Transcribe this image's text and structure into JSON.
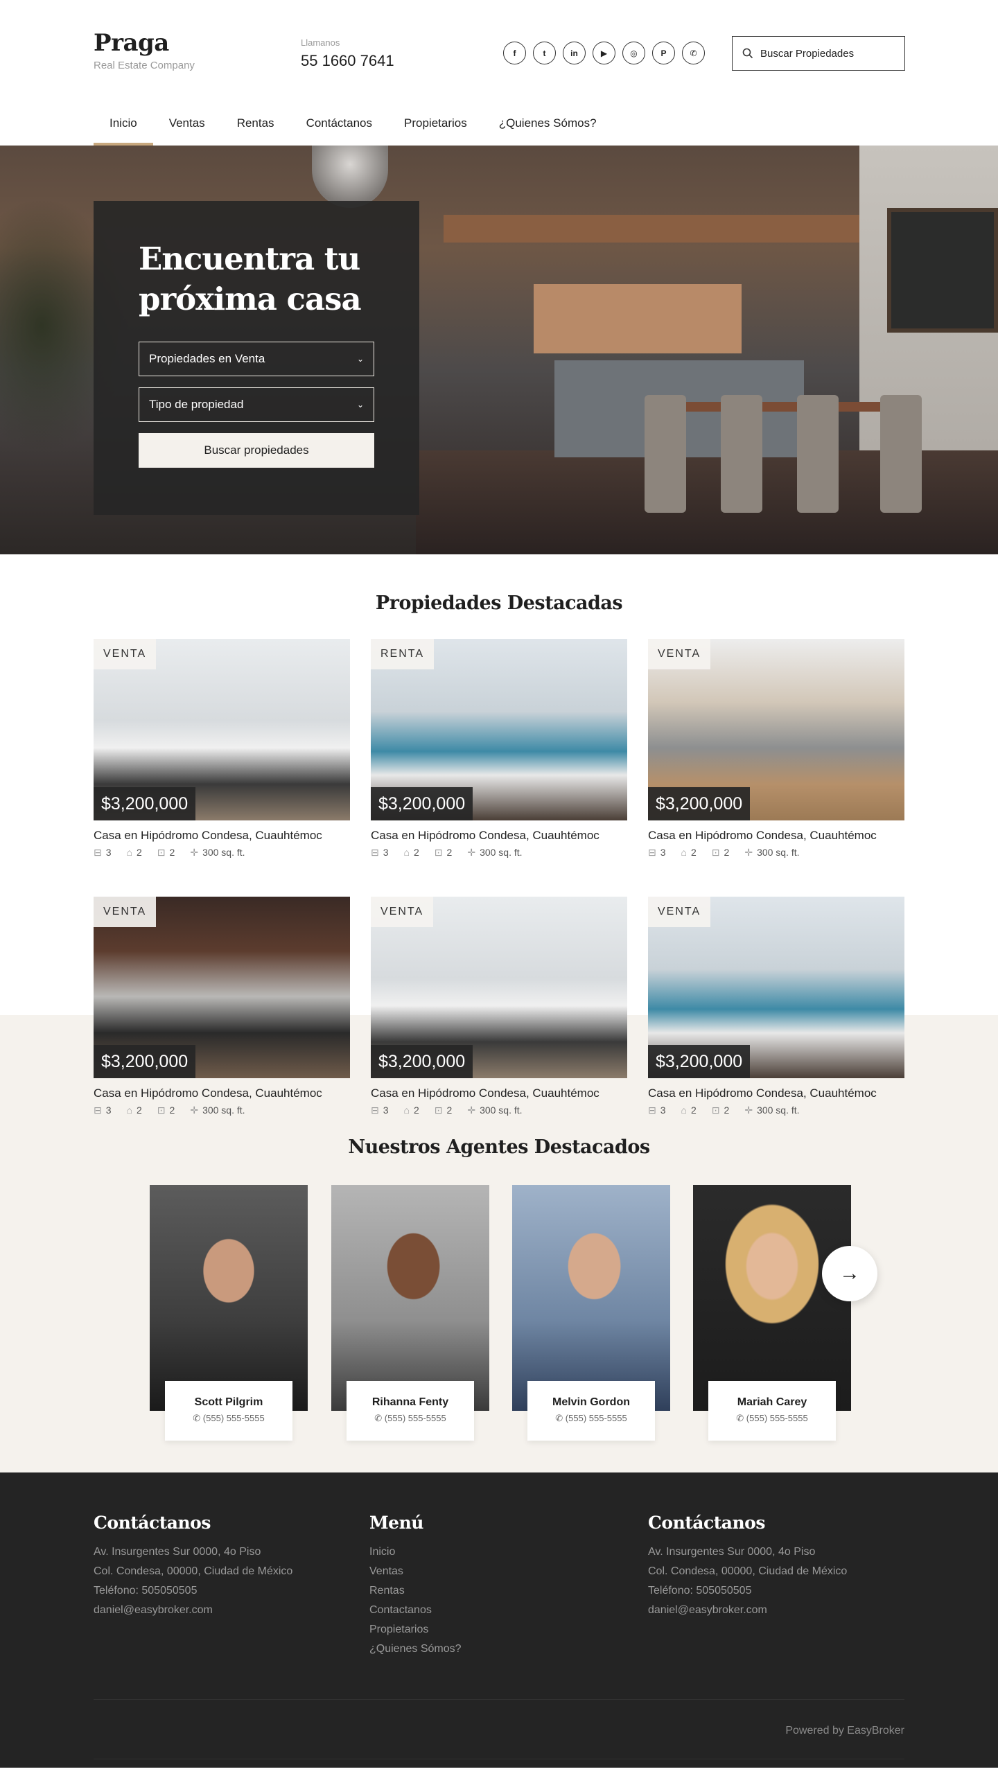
{
  "header": {
    "brand_name": "Praga",
    "brand_sub": "Real Estate Company",
    "call_label": "Llamanos",
    "call_number": "55 1660 7641",
    "socials": [
      "f",
      "t",
      "in",
      "▶",
      "◎",
      "P",
      "✆"
    ],
    "search_placeholder": "Buscar Propiedades"
  },
  "nav": [
    "Inicio",
    "Ventas",
    "Rentas",
    "Contáctanos",
    "Propietarios",
    "¿Quienes Sómos?"
  ],
  "hero": {
    "title_line1": "Encuentra tu",
    "title_line2": "próxima casa",
    "select1": "Propiedades en Venta",
    "select2": "Tipo de propiedad",
    "button": "Buscar propiedades"
  },
  "featured": {
    "title": "Propiedades Destacadas",
    "cards": [
      {
        "tag": "VENTA",
        "price": "$3,200,000",
        "name": "Casa en Hipódromo Condesa, Cuauhtémoc",
        "beds": "3",
        "baths": "2",
        "parking": "2",
        "area": "300 sq. ft."
      },
      {
        "tag": "RENTA",
        "price": "$3,200,000",
        "name": "Casa en Hipódromo Condesa, Cuauhtémoc",
        "beds": "3",
        "baths": "2",
        "parking": "2",
        "area": "300 sq. ft."
      },
      {
        "tag": "VENTA",
        "price": "$3,200,000",
        "name": "Casa en Hipódromo Condesa, Cuauhtémoc",
        "beds": "3",
        "baths": "2",
        "parking": "2",
        "area": "300 sq. ft."
      },
      {
        "tag": "VENTA",
        "price": "$3,200,000",
        "name": "Casa en Hipódromo Condesa, Cuauhtémoc",
        "beds": "3",
        "baths": "2",
        "parking": "2",
        "area": "300 sq. ft."
      },
      {
        "tag": "VENTA",
        "price": "$3,200,000",
        "name": "Casa en Hipódromo Condesa, Cuauhtémoc",
        "beds": "3",
        "baths": "2",
        "parking": "2",
        "area": "300 sq. ft."
      },
      {
        "tag": "VENTA",
        "price": "$3,200,000",
        "name": "Casa en Hipódromo Condesa, Cuauhtémoc",
        "beds": "3",
        "baths": "2",
        "parking": "2",
        "area": "300 sq. ft."
      }
    ]
  },
  "agents": {
    "title": "Nuestros Agentes Destacados",
    "list": [
      {
        "name": "Scott Pilgrim",
        "phone": "(555) 555-5555"
      },
      {
        "name": "Rihanna Fenty",
        "phone": "(555) 555-5555"
      },
      {
        "name": "Melvin Gordon",
        "phone": "(555) 555-5555"
      },
      {
        "name": "Mariah Carey",
        "phone": "(555) 555-5555"
      }
    ]
  },
  "footer": {
    "contact1": {
      "title": "Contáctanos",
      "lines": [
        "Av. Insurgentes Sur 0000, 4o Piso",
        "Col. Condesa, 00000, Ciudad de México",
        "Teléfono: 505050505",
        "daniel@easybroker.com"
      ]
    },
    "menu": {
      "title": "Menú",
      "links": [
        "Inicio",
        "Ventas",
        "Rentas",
        "Contactanos",
        "Propietarios",
        "¿Quienes Sómos?"
      ]
    },
    "contact2": {
      "title": "Contáctanos",
      "lines": [
        "Av. Insurgentes Sur 0000, 4o Piso",
        "Col. Condesa, 00000, Ciudad de México",
        "Teléfono: 505050505",
        "daniel@easybroker.com"
      ]
    },
    "powered": "Powered by EasyBroker"
  },
  "colors": {
    "accent": "#c8a87e",
    "dark": "#242424",
    "cream": "#f5f2ed"
  }
}
